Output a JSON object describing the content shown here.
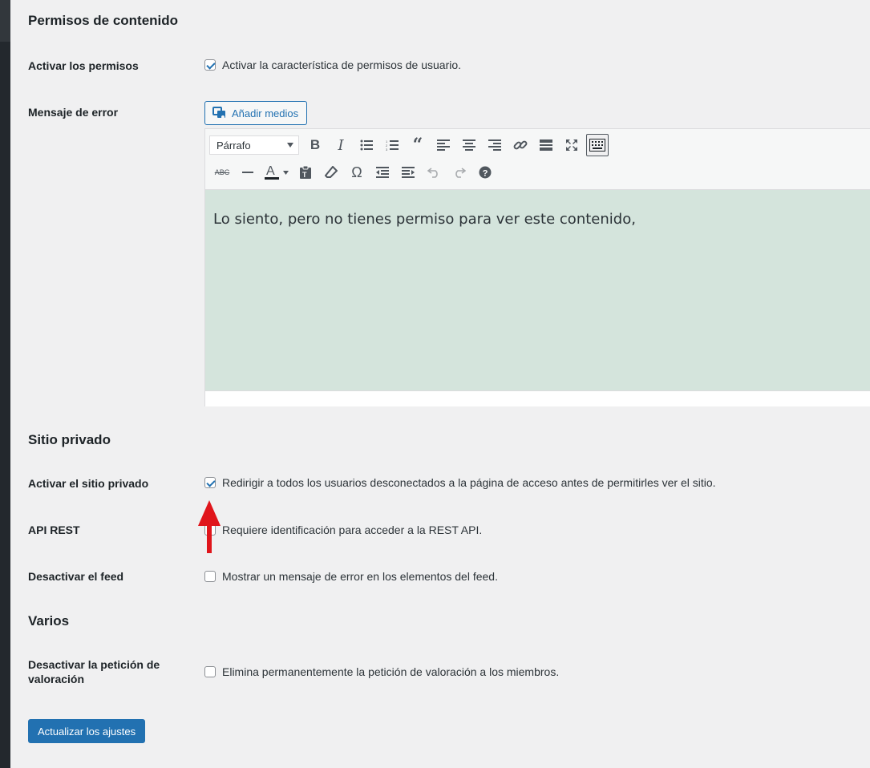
{
  "sections": {
    "content_permissions": "Permisos de contenido",
    "private_site": "Sitio privado",
    "misc": "Varios"
  },
  "rows": {
    "enable_permissions": {
      "label": "Activar los permisos",
      "text": "Activar la característica de permisos de usuario.",
      "checked": true
    },
    "error_message": {
      "label": "Mensaje de error"
    },
    "enable_private_site": {
      "label": "Activar el sitio privado",
      "text": "Redirigir a todos los usuarios desconectados a la página de acceso antes de permitirles ver el sitio.",
      "checked": true
    },
    "rest_api": {
      "label": "API REST",
      "text": "Requiere identificación para acceder a la REST API.",
      "checked": false
    },
    "disable_feed": {
      "label": "Desactivar el feed",
      "text": "Mostrar un mensaje de error en los elementos del feed.",
      "checked": false
    },
    "disable_rating": {
      "label": "Desactivar la petición de valoración",
      "text": "Elimina permanentemente la petición de valoración a los miembros.",
      "checked": false
    }
  },
  "editor": {
    "add_media": "Añadir medios",
    "format": "Párrafo",
    "content": "Lo siento, pero no tienes permiso para ver este contenido,",
    "toolbar1": [
      "bold-icon",
      "italic-icon",
      "bullet-list-icon",
      "numbered-list-icon",
      "blockquote-icon",
      "align-left-icon",
      "align-center-icon",
      "align-right-icon",
      "link-icon",
      "read-more-icon",
      "fullscreen-icon",
      "toolbar-toggle-icon"
    ],
    "toolbar2": [
      "strikethrough-icon",
      "horizontal-line-icon",
      "text-color-icon",
      "paste-text-icon",
      "clear-formatting-icon",
      "special-character-icon",
      "outdent-icon",
      "indent-icon",
      "undo-icon",
      "redo-icon",
      "help-icon"
    ]
  },
  "submit": "Actualizar los ajustes",
  "colors": {
    "accent": "#2271b1",
    "editor_bg": "#d4e4dc",
    "arrow": "#e0151b",
    "page_bg": "#f0f0f1"
  }
}
